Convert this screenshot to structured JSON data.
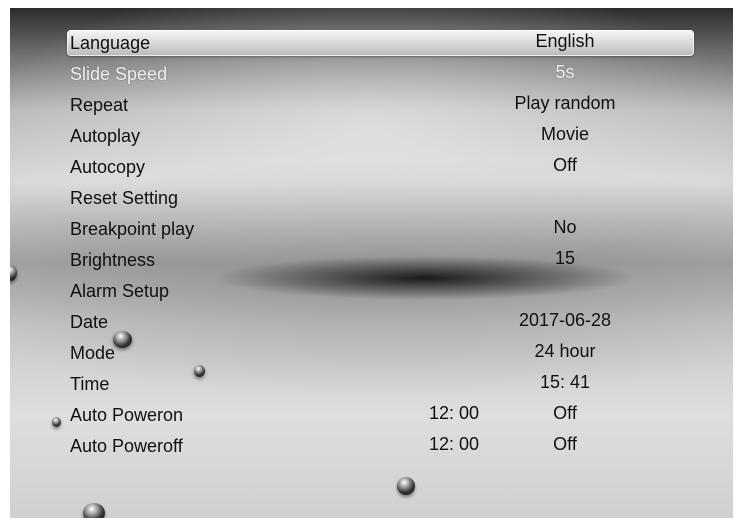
{
  "menu": {
    "rows": [
      {
        "label": "Language",
        "value": "English"
      },
      {
        "label": "Slide Speed",
        "value": "5s"
      },
      {
        "label": "Repeat",
        "value": "Play random"
      },
      {
        "label": "Autoplay",
        "value": "Movie"
      },
      {
        "label": "Autocopy",
        "value": "Off"
      },
      {
        "label": "Reset Setting",
        "value": ""
      },
      {
        "label": "Breakpoint play",
        "value": "No"
      },
      {
        "label": "Brightness",
        "value": "15"
      },
      {
        "label": "Alarm Setup",
        "value": ""
      },
      {
        "label": "Date",
        "value": "2017-06-28"
      },
      {
        "label": "Mode",
        "value": "24 hour"
      },
      {
        "label": "Time",
        "value": "15: 41"
      },
      {
        "label": "Auto Poweron",
        "time": "12: 00",
        "value": "Off"
      },
      {
        "label": "Auto Poweroff",
        "time": "12: 00",
        "value": "Off"
      }
    ],
    "selected_index": 0
  }
}
